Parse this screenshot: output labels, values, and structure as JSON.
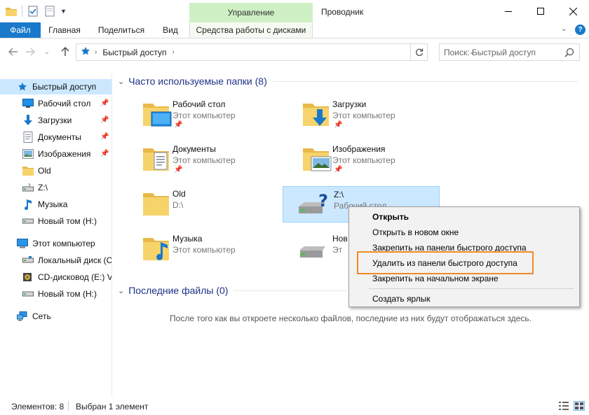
{
  "window": {
    "title": "Проводник",
    "manage_tab": "Управление"
  },
  "ribbon": {
    "tabs": [
      "Файл",
      "Главная",
      "Поделиться",
      "Вид",
      "Средства работы с дисками"
    ],
    "help": "?"
  },
  "address": {
    "path": "Быстрый доступ"
  },
  "search": {
    "placeholder": "Поиск: Быстрый доступ"
  },
  "navpane": {
    "items": [
      {
        "label": "Быстрый доступ",
        "icon": "star-icon"
      },
      {
        "label": "Рабочий стол",
        "icon": "desktop-icon",
        "pinned": true
      },
      {
        "label": "Загрузки",
        "icon": "download-icon",
        "pinned": true
      },
      {
        "label": "Документы",
        "icon": "documents-icon",
        "pinned": true
      },
      {
        "label": "Изображения",
        "icon": "pictures-icon",
        "pinned": true
      },
      {
        "label": "Old",
        "icon": "folder-icon"
      },
      {
        "label": "Z:\\",
        "icon": "network-drive-icon"
      },
      {
        "label": "Музыка",
        "icon": "music-icon"
      },
      {
        "label": "Новый том (H:)",
        "icon": "drive-icon"
      },
      {
        "label": "Этот компьютер",
        "icon": "computer-icon"
      },
      {
        "label": "Локальный диск (C",
        "icon": "local-disk-icon"
      },
      {
        "label": "CD-дисковод (E:) V",
        "icon": "cd-drive-icon"
      },
      {
        "label": "Новый том (H:)",
        "icon": "drive-icon"
      },
      {
        "label": "Сеть",
        "icon": "network-icon"
      }
    ]
  },
  "content": {
    "frequent_header": "Часто используемые папки (8)",
    "recent_header": "Последние файлы (0)",
    "empty_message": "После того как вы откроете несколько файлов, последние из них будут отображаться здесь.",
    "tiles": [
      {
        "name": "Рабочий стол",
        "sub": "Этот компьютер"
      },
      {
        "name": "Загрузки",
        "sub": "Этот компьютер"
      },
      {
        "name": "Документы",
        "sub": "Этот компьютер"
      },
      {
        "name": "Изображения",
        "sub": "Этот компьютер"
      },
      {
        "name": "Old",
        "sub": "D:\\"
      },
      {
        "name": "Z:\\",
        "sub": "Рабочий стол"
      },
      {
        "name": "Музыка",
        "sub": "Этот компьютер"
      },
      {
        "name": "Нов",
        "sub": "Эт"
      }
    ]
  },
  "context_menu": {
    "items": [
      "Открыть",
      "Открыть в новом окне",
      "Закрепить на панели быстрого доступа",
      "Удалить из панели быстрого доступа",
      "Закрепить на начальном экране",
      "Создать ярлык"
    ]
  },
  "status": {
    "items_count": "Элементов: 8",
    "selected": "Выбран 1 элемент"
  },
  "colors": {
    "accent": "#1979ca",
    "selection": "#cce8ff",
    "manage_tab": "#cff0c4",
    "highlight": "#f08a24",
    "group_header": "#1e3287"
  }
}
